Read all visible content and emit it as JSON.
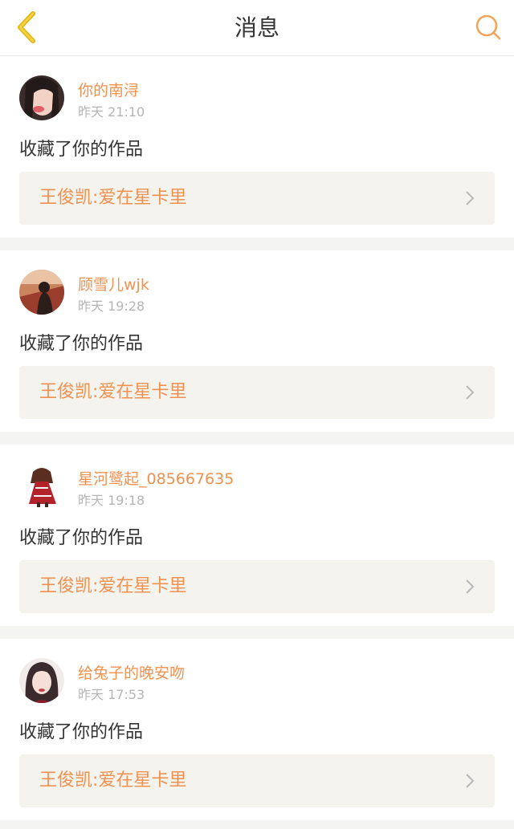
{
  "header": {
    "title": "消息",
    "back_icon": "chevron-left-icon",
    "search_icon": "search-icon",
    "accent_color": "#f0c419",
    "search_color": "#f5a45c"
  },
  "messages": [
    {
      "username": "你的南浔",
      "time": "昨天 21:10",
      "action": "收藏了你的作品",
      "work_title": "王俊凯:爱在星卡里"
    },
    {
      "username": "顾雪儿wjk",
      "time": "昨天 19:28",
      "action": "收藏了你的作品",
      "work_title": "王俊凯:爱在星卡里"
    },
    {
      "username": "星河鹭起_085667635",
      "time": "昨天 19:18",
      "action": "收藏了你的作品",
      "work_title": "王俊凯:爱在星卡里"
    },
    {
      "username": "给兔子的晚安吻",
      "time": "昨天 17:53",
      "action": "收藏了你的作品",
      "work_title": "王俊凯:爱在星卡里"
    }
  ],
  "colors": {
    "username": "#f0914f",
    "work_title": "#f0914f",
    "timestamp": "#b5b5b5",
    "body_text": "#333333",
    "card_inner_bg": "#f4f3ee",
    "separator_bg": "#f4f4f2"
  }
}
